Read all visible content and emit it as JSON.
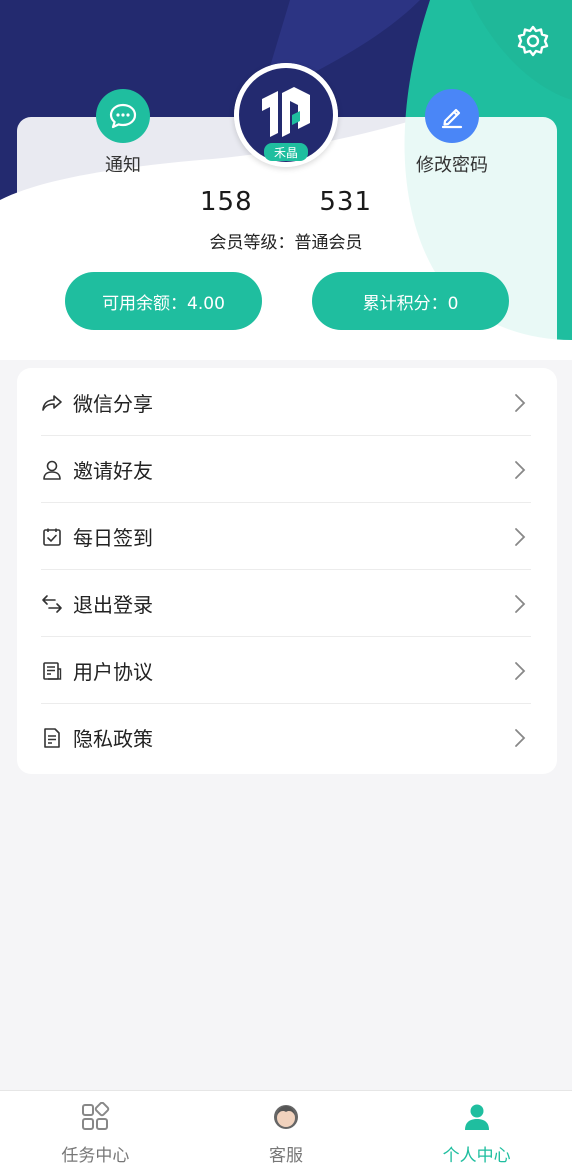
{
  "header": {
    "notify_label": "通知",
    "change_password_label": "修改密码",
    "avatar_badge_text": "禾晶",
    "phone_prefix": "158",
    "phone_suffix": "531",
    "member_level": "会员等级：普通会员"
  },
  "stats": {
    "balance_label": "可用余额：4.00",
    "points_label": "累计积分：0"
  },
  "menu": {
    "items": [
      {
        "label": "微信分享",
        "icon": "share-icon"
      },
      {
        "label": "邀请好友",
        "icon": "user-icon"
      },
      {
        "label": "每日签到",
        "icon": "calendar-check-icon"
      },
      {
        "label": "退出登录",
        "icon": "swap-arrows-icon"
      },
      {
        "label": "用户协议",
        "icon": "document-icon"
      },
      {
        "label": "隐私政策",
        "icon": "policy-icon"
      }
    ]
  },
  "tabbar": {
    "tabs": [
      {
        "label": "任务中心",
        "icon": "grid-icon",
        "active": false
      },
      {
        "label": "客服",
        "icon": "customer-service-icon",
        "active": false
      },
      {
        "label": "个人中心",
        "icon": "person-icon",
        "active": true
      }
    ]
  },
  "colors": {
    "accent": "#1fbe9f",
    "header_navy": "#232a6f",
    "password_button": "#4a86f7"
  }
}
